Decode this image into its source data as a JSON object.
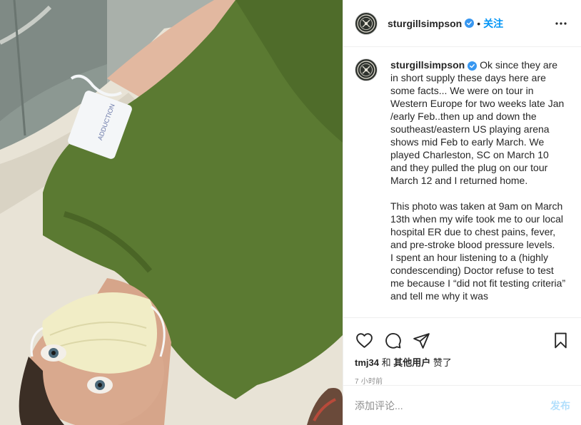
{
  "post": {
    "username": "sturgillsimpson",
    "follow_label": "关注",
    "caption_user": "sturgillsimpson",
    "caption_body": "Ok since they are in short supply these days here are some facts... We were on tour in Western Europe for two weeks late Jan /early Feb..then up and down the southeast/eastern US playing arena shows mid Feb to early March. We played Charleston, SC on March 10 and they pulled the plug on our tour March 12 and I returned home.\n\nThis photo was taken at 9am on March 13th when my wife took me to our local hospital ER due to chest pains, fever, and pre-stroke blood pressure levels.\nI spent an hour listening to a (highly condescending) Doctor refuse to test me because I “did not fit testing criteria” and tell me why it was",
    "likes_user": "tmj34",
    "likes_and": " 和 ",
    "likes_others": "其他用户",
    "likes_suffix": " 赞了",
    "time_ago": "7 小时前",
    "comment_placeholder": "添加评论...",
    "post_label": "发布"
  },
  "photo": {
    "wristband_text": "ADDUCTION"
  },
  "icons": {
    "verified": "verified-badge-icon",
    "more": "more-options-icon",
    "like": "heart-icon",
    "comment": "comment-icon",
    "share": "paper-plane-icon",
    "save": "bookmark-icon"
  },
  "colors": {
    "accent": "#0095f6",
    "verified": "#3897f0",
    "post_disabled": "#b2dffc",
    "shirt": "#5b7a32"
  }
}
